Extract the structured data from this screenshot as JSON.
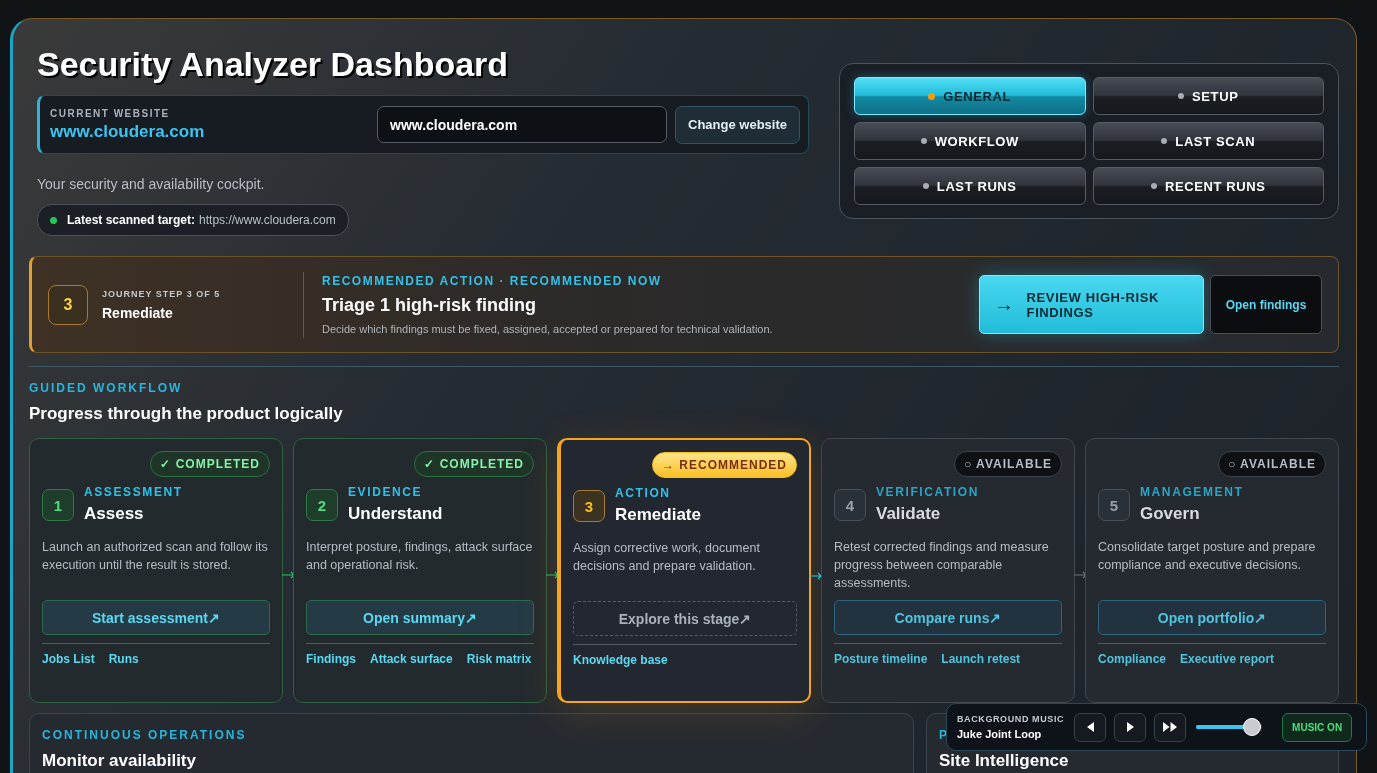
{
  "header": {
    "title": "Security Analyzer Dashboard",
    "current_website": {
      "label": "CURRENT WEBSITE",
      "value": "www.cloudera.com"
    },
    "website_field": {
      "value": "www.cloudera.com"
    },
    "change_button": "Change website",
    "tagline": "Your security and availability cockpit.",
    "latest_target": {
      "label": "Latest scanned target:",
      "value": "https://www.cloudera.com",
      "color": "#22c55e"
    }
  },
  "nav": [
    {
      "label": "GENERAL",
      "selected": true
    },
    {
      "label": "SETUP",
      "selected": false
    },
    {
      "label": "WORKFLOW",
      "selected": false
    },
    {
      "label": "LAST SCAN",
      "selected": false
    },
    {
      "label": "LAST RUNS",
      "selected": false
    },
    {
      "label": "RECENT RUNS",
      "selected": false
    }
  ],
  "journey": {
    "step_number": "3",
    "step_caption": "JOURNEY STEP 3 OF 5",
    "step_name": "Remediate",
    "eyebrow": "RECOMMENDED ACTION · RECOMMENDED NOW",
    "title": "Triage 1 high-risk finding",
    "description": "Decide which findings must be fixed, assigned, accepted or prepared for technical validation.",
    "primary_button": {
      "icon": "→",
      "label": "REVIEW HIGH-RISK FINDINGS"
    },
    "secondary_button": "Open findings"
  },
  "workflow": {
    "eyebrow": "GUIDED WORKFLOW",
    "heading": "Progress through the product logically",
    "steps": [
      {
        "kind": "completed",
        "badge": "✓ COMPLETED",
        "number": "1",
        "category": "ASSESSMENT",
        "title": "Assess",
        "description": "Launch an authorized scan and follow its execution until the result is stored.",
        "action": "Start assessment↗",
        "links": [
          "Jobs List",
          "Runs"
        ]
      },
      {
        "kind": "completed",
        "badge": "✓ COMPLETED",
        "number": "2",
        "category": "EVIDENCE",
        "title": "Understand",
        "description": "Interpret posture, findings, attack surface and operational risk.",
        "action": "Open summary↗",
        "links": [
          "Findings",
          "Attack surface",
          "Risk matrix"
        ]
      },
      {
        "kind": "recommended",
        "badge": "→ RECOMMENDED",
        "number": "3",
        "category": "ACTION",
        "title": "Remediate",
        "description": "Assign corrective work, document decisions and prepare validation.",
        "action": "Explore this stage↗",
        "links": [
          "Knowledge base"
        ]
      },
      {
        "kind": "available",
        "badge": "○ AVAILABLE",
        "number": "4",
        "category": "VERIFICATION",
        "title": "Validate",
        "description": "Retest corrected findings and measure progress between comparable assessments.",
        "action": "Compare runs↗",
        "links": [
          "Posture timeline",
          "Launch retest"
        ]
      },
      {
        "kind": "available",
        "badge": "○ AVAILABLE",
        "number": "5",
        "category": "MANAGEMENT",
        "title": "Govern",
        "description": "Consolidate target posture and prepare compliance and executive decisions.",
        "action": "Open portfolio↗",
        "links": [
          "Compliance",
          "Executive report"
        ]
      }
    ]
  },
  "bottom_panels": [
    {
      "eyebrow": "CONTINUOUS OPERATIONS",
      "heading": "Monitor availability"
    },
    {
      "eyebrow": "P",
      "heading": "Site Intelligence"
    }
  ],
  "music_player": {
    "label": "BACKGROUND MUSIC",
    "track": "Juke Joint Loop",
    "level": 0.85,
    "toggle": {
      "label": "MUSIC ON",
      "on": true
    }
  }
}
